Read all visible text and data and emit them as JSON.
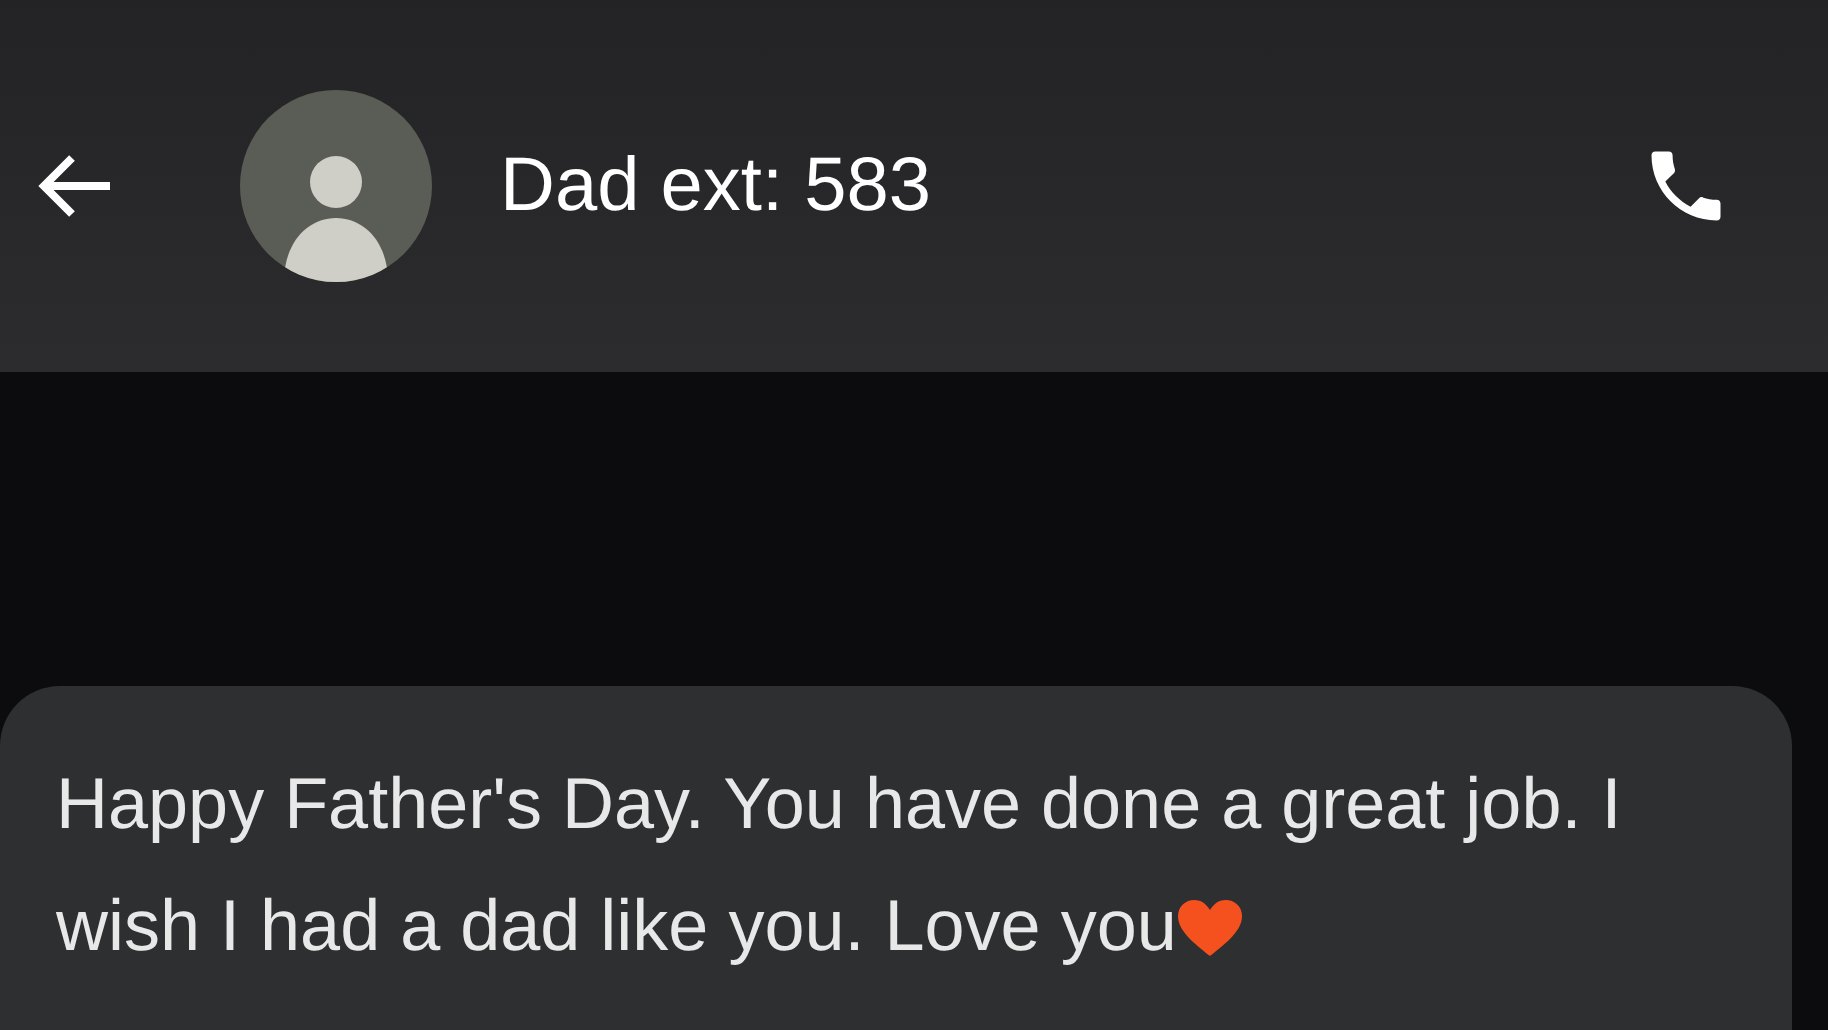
{
  "header": {
    "title": "Dad ext: 583"
  },
  "messages": [
    {
      "text": "Happy Father's Day. You have done a great job. I wish I had a dad like you. Love you"
    }
  ]
}
